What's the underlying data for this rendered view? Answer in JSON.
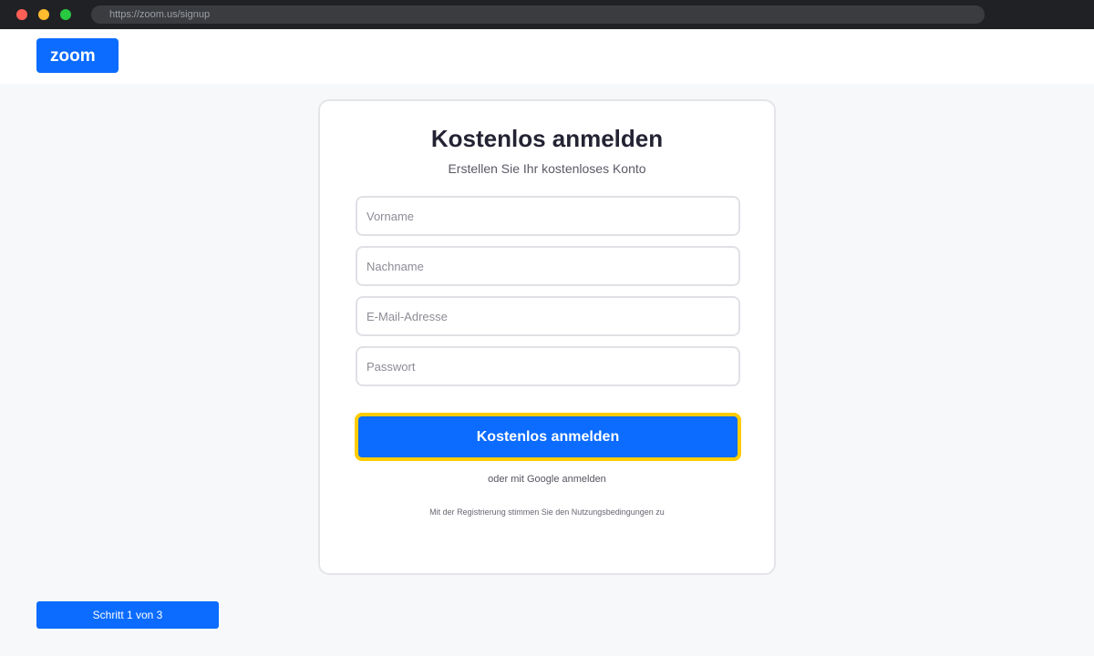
{
  "browser": {
    "url": "https://zoom.us/signup"
  },
  "header": {
    "logo_text": "zoom"
  },
  "signup": {
    "title": "Kostenlos anmelden",
    "subtitle": "Erstellen Sie Ihr kostenloses Konto",
    "fields": [
      {
        "placeholder": "Vorname",
        "value": ""
      },
      {
        "placeholder": "Nachname",
        "value": ""
      },
      {
        "placeholder": "E-Mail-Adresse",
        "value": ""
      },
      {
        "placeholder": "Passwort",
        "value": ""
      }
    ],
    "submit_label": "Kostenlos anmelden",
    "google_link": "oder mit Google anmelden",
    "terms_text": "Mit der Registrierung stimmen Sie den Nutzungsbedingungen zu"
  },
  "progress": {
    "step_label": "Schritt 1 von 3"
  },
  "colors": {
    "brand": "#0b6cff",
    "highlight": "#ffcc00",
    "traffic_red": "#ff5f57",
    "traffic_yellow": "#febc2e",
    "traffic_green": "#28c840"
  }
}
